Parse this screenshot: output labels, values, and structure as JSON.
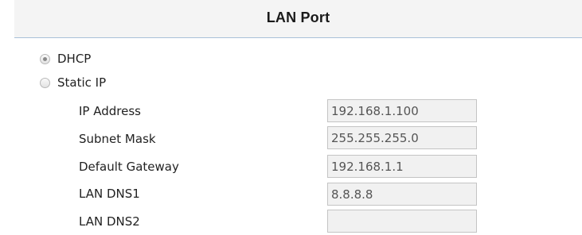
{
  "section": {
    "title": "LAN Port"
  },
  "mode": {
    "options": [
      {
        "label": "DHCP",
        "selected": true
      },
      {
        "label": "Static IP",
        "selected": false
      }
    ]
  },
  "fields": [
    {
      "label": "IP Address",
      "value": "192.168.1.100"
    },
    {
      "label": "Subnet Mask",
      "value": "255.255.255.0"
    },
    {
      "label": "Default Gateway",
      "value": "192.168.1.1"
    },
    {
      "label": "LAN DNS1",
      "value": "8.8.8.8"
    },
    {
      "label": "LAN DNS2",
      "value": ""
    }
  ],
  "colors": {
    "header_bg": "#f4f4f4",
    "header_rule": "#a9c1d9",
    "input_bg": "#f1f1f1",
    "input_border": "#c4c4c4"
  }
}
